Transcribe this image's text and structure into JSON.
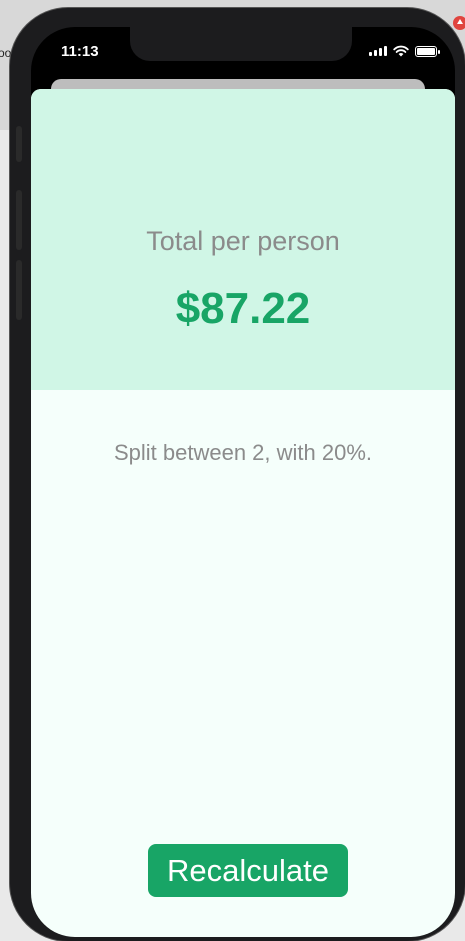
{
  "host": {
    "partial_text": "oo"
  },
  "status_bar": {
    "time": "11:13"
  },
  "result": {
    "title": "Total per person",
    "amount": "$87.22"
  },
  "settings": {
    "text": "Split between 2, with 20%."
  },
  "actions": {
    "recalculate_label": "Recalculate"
  },
  "colors": {
    "accent": "#18a566",
    "result_background": "#d0f6e6",
    "sheet_background": "#f5fffb",
    "secondary_text": "#8b8b8b"
  },
  "icons": [
    "signal-icon",
    "wifi-icon",
    "battery-icon"
  ]
}
